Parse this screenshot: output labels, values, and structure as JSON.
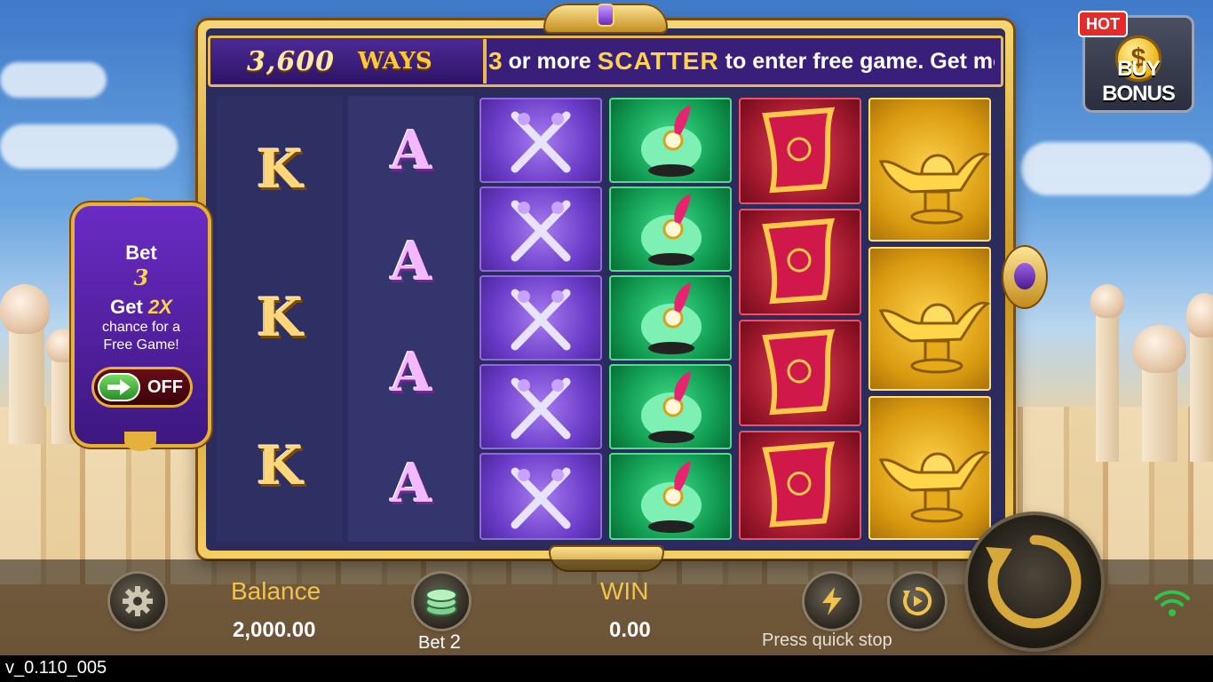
{
  "ways": {
    "number": "3,600",
    "word": "WAYS"
  },
  "marquee": {
    "num": "3",
    "pre": " or more ",
    "scatter": "SCATTER",
    "post": " to enter free game. Get mo"
  },
  "reels": {
    "col1": [
      "K",
      "K",
      "K"
    ],
    "col2": [
      "A",
      "A",
      "A",
      "A"
    ],
    "col3": [
      "crossed-swords",
      "crossed-swords",
      "crossed-swords",
      "crossed-swords",
      "crossed-swords"
    ],
    "col4": [
      "feathered-turban",
      "feathered-turban",
      "feathered-turban",
      "feathered-turban",
      "feathered-turban"
    ],
    "col5": [
      "magic-carpet",
      "magic-carpet",
      "magic-carpet",
      "magic-carpet"
    ],
    "col6": [
      "golden-lamp",
      "golden-lamp",
      "golden-lamp"
    ]
  },
  "bet_panel": {
    "title": "Bet",
    "bet_value": "3",
    "get_prefix": "Get ",
    "multiplier": "2X",
    "line1": "chance for a",
    "line2": "Free Game!",
    "toggle_state": "OFF"
  },
  "buy_bonus": {
    "hot": "HOT",
    "label": "BUY BONUS"
  },
  "bottom": {
    "balance_label": "Balance",
    "balance_value": "2,000.00",
    "bet_label": "Bet",
    "bet_value": "2",
    "win_label": "WIN",
    "win_value": "0.00",
    "quick_stop": "Press quick stop"
  },
  "version": "v_0.110_005",
  "colors": {
    "gold": "#f2c34a",
    "frame": "#c9921d",
    "reel_bg": "#2e2f63"
  }
}
